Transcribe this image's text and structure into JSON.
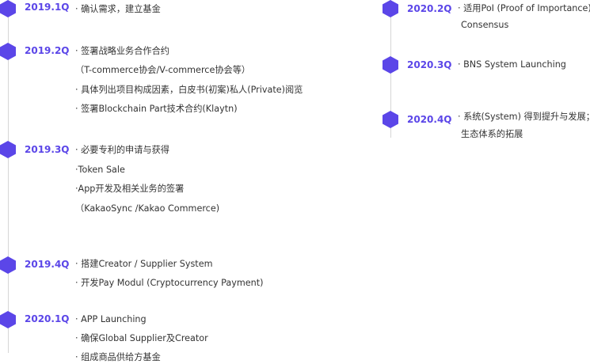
{
  "colors": {
    "accent": "#5b46e8",
    "line": "#d6d6d6",
    "text": "#333333"
  },
  "left_timeline": {
    "entries": [
      {
        "quarter": "2019.1Q",
        "items": [
          "· 确认需求，建立基金"
        ]
      },
      {
        "quarter": "2019.2Q",
        "items": [
          "· 签署战略业务合作合约",
          "（T-commerce协会/V-commerce协会等）",
          "· 具体列出项目构成因素，白皮书(初案)私人(Private)阅览",
          "· 签署Blockchain Part技术合约(Klaytn)"
        ]
      },
      {
        "quarter": "2019.3Q",
        "items": [
          "· 必要专利的申请与获得",
          "·Token Sale",
          "·App开发及相关业务的签署",
          "（KakaoSync /Kakao Commerce)"
        ]
      },
      {
        "quarter": "2019.4Q",
        "items": [
          "· 搭建Creator / Supplier System",
          "· 开发Pay Modul (Cryptocurrency Payment)"
        ]
      },
      {
        "quarter": "2020.1Q",
        "items": [
          "· APP Launching",
          "· 确保Global Supplier及Creator",
          "· 组成商品供给方基金"
        ]
      }
    ]
  },
  "right_timeline": {
    "entries": [
      {
        "quarter": "2020.2Q",
        "items": [
          "· 适用PoI (Proof of Importance)",
          "Consensus"
        ]
      },
      {
        "quarter": "2020.3Q",
        "items": [
          "· BNS System Launching"
        ]
      },
      {
        "quarter": "2020.4Q",
        "items": [
          "· 系统(System) 得到提升与发展；",
          "生态体系的拓展"
        ]
      }
    ]
  }
}
